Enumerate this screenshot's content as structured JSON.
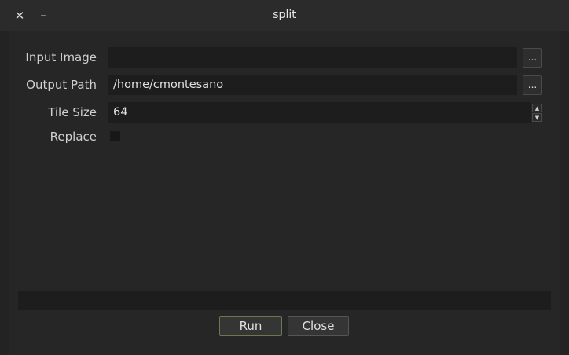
{
  "window": {
    "title": "split",
    "close_glyph": "✕",
    "minimize_glyph": "–"
  },
  "form": {
    "input_image": {
      "label": "Input Image",
      "value": "",
      "browse_label": "..."
    },
    "output_path": {
      "label": "Output Path",
      "value": "/home/cmontesano",
      "browse_label": "..."
    },
    "tile_size": {
      "label": "Tile Size",
      "value": "64"
    },
    "replace": {
      "label": "Replace",
      "checked": false
    }
  },
  "progress": {
    "value": 0
  },
  "buttons": {
    "run_label": "Run",
    "close_label": "Close"
  },
  "colors": {
    "background": "#232323",
    "field": "#1d1d1d",
    "run_border_accent": "#6a7a4e"
  },
  "icons": {
    "close": "close-icon",
    "minimize": "minimize-icon",
    "spin_up": "chevron-up-icon",
    "spin_down": "chevron-down-icon"
  }
}
